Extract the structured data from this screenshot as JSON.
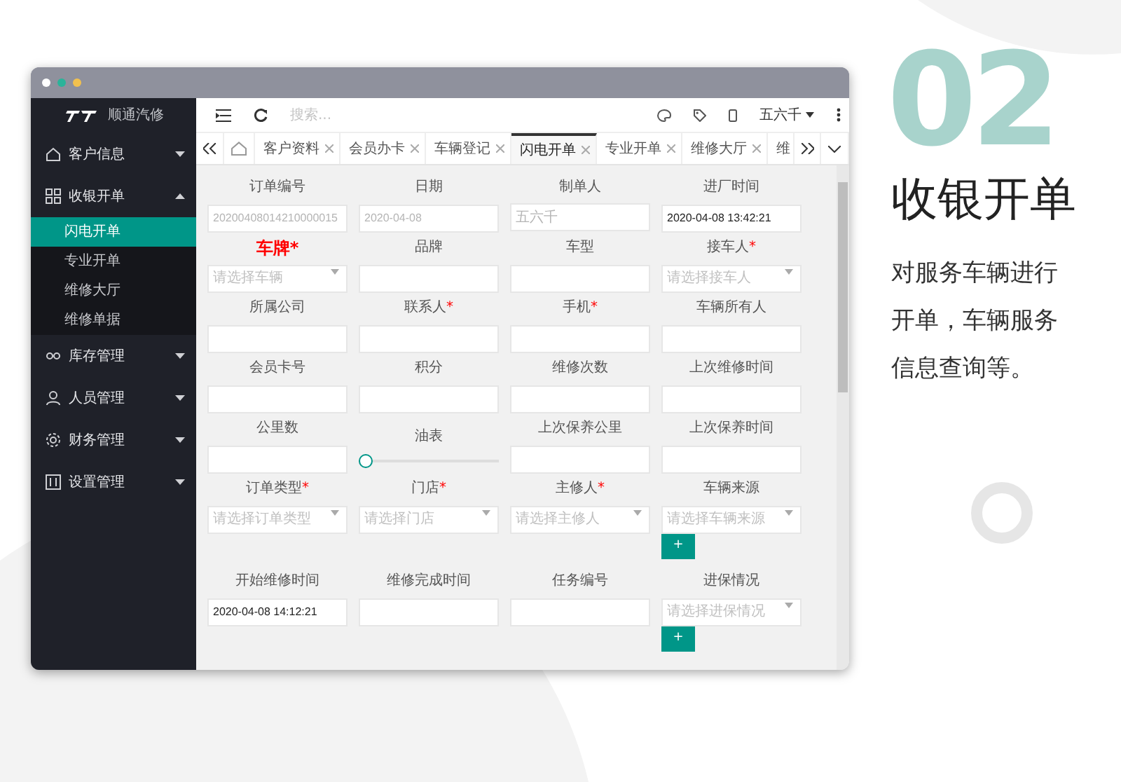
{
  "feature": {
    "number": "02",
    "title": "收银开单",
    "description": "对服务车辆进行开单，车辆服务信息查询等。"
  },
  "sidebar": {
    "logo_text": "顺通汽修",
    "items": [
      {
        "label": "客户信息",
        "expanded": false
      },
      {
        "label": "收银开单",
        "expanded": true,
        "children": [
          {
            "label": "闪电开单",
            "selected": true
          },
          {
            "label": "专业开单",
            "selected": false
          },
          {
            "label": "维修大厅",
            "selected": false
          },
          {
            "label": "维修单据",
            "selected": false
          }
        ]
      },
      {
        "label": "库存管理",
        "expanded": false
      },
      {
        "label": "人员管理",
        "expanded": false
      },
      {
        "label": "财务管理",
        "expanded": false
      },
      {
        "label": "设置管理",
        "expanded": false
      }
    ]
  },
  "toolbar": {
    "search": {
      "placeholder": "搜索..."
    },
    "user": "五六千"
  },
  "tabs": [
    {
      "label": "客户资料",
      "selected": false
    },
    {
      "label": "会员办卡",
      "selected": false
    },
    {
      "label": "车辆登记",
      "selected": false
    },
    {
      "label": "闪电开单",
      "selected": true
    },
    {
      "label": "专业开单",
      "selected": false
    },
    {
      "label": "维修大厅",
      "selected": false
    },
    {
      "label": "维",
      "selected": false
    }
  ],
  "form": {
    "fields": [
      {
        "kind": "text",
        "label": "订单编号",
        "value": "20200408014210000015",
        "disabled": true
      },
      {
        "kind": "text",
        "label": "日期",
        "value": "2020-04-08",
        "disabled": true
      },
      {
        "kind": "text",
        "label": "制单人",
        "value": "五六千",
        "disabled": true
      },
      {
        "kind": "text",
        "label": "进厂时间",
        "value": "2020-04-08 13:42:21"
      },
      {
        "kind": "select",
        "label": "车牌",
        "required_mark": "*",
        "highlight": true,
        "placeholder": "请选择车辆"
      },
      {
        "kind": "text",
        "label": "品牌"
      },
      {
        "kind": "text",
        "label": "车型"
      },
      {
        "kind": "select",
        "label": "接车人",
        "required_mark": "*",
        "placeholder": "请选择接车人"
      },
      {
        "kind": "text",
        "label": "所属公司"
      },
      {
        "kind": "text",
        "label": "联系人",
        "required_mark": "*"
      },
      {
        "kind": "text",
        "label": "手机",
        "required_mark": "*"
      },
      {
        "kind": "text",
        "label": "车辆所有人"
      },
      {
        "kind": "text",
        "label": "会员卡号"
      },
      {
        "kind": "text",
        "label": "积分"
      },
      {
        "kind": "text",
        "label": "维修次数"
      },
      {
        "kind": "text",
        "label": "上次维修时间"
      },
      {
        "kind": "text",
        "label": "公里数"
      },
      {
        "kind": "slider",
        "label": "油表",
        "level": 0
      },
      {
        "kind": "text",
        "label": "上次保养公里"
      },
      {
        "kind": "text",
        "label": "上次保养时间"
      },
      {
        "kind": "select",
        "label": "订单类型",
        "required_mark": "*",
        "placeholder": "请选择订单类型"
      },
      {
        "kind": "select",
        "label": "门店",
        "required_mark": "*",
        "placeholder": "请选择门店"
      },
      {
        "kind": "select",
        "label": "主修人",
        "required_mark": "*",
        "placeholder": "请选择主修人"
      },
      {
        "kind": "select",
        "label": "车辆来源",
        "placeholder": "请选择车辆来源",
        "add_button": "+"
      },
      {
        "kind": "text",
        "label": "开始维修时间",
        "value": "2020-04-08 14:12:21"
      },
      {
        "kind": "text",
        "label": "维修完成时间"
      },
      {
        "kind": "text",
        "label": "任务编号"
      },
      {
        "kind": "select",
        "label": "进保情况",
        "placeholder": "请选择进保情况",
        "add_button": "+"
      }
    ]
  }
}
